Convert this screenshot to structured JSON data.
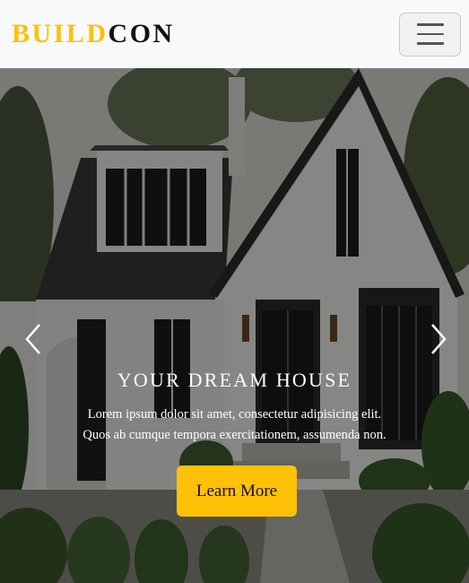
{
  "navbar": {
    "brand_part1": "BUILD",
    "brand_part2": "CON",
    "toggler_icon": "hamburger-menu-icon"
  },
  "hero": {
    "title": "YOUR DREAM HOUSE",
    "text_line1": "Lorem ipsum dolor sit amet, consectetur adipisicing elit.",
    "text_line2": "Quos ab cumque tempora exercitationem, assumenda non.",
    "button_label": "Learn More",
    "prev_icon": "chevron-left-icon",
    "next_icon": "chevron-right-icon"
  },
  "colors": {
    "accent": "#ffc107",
    "navbar_bg": "#f8f9fa"
  }
}
